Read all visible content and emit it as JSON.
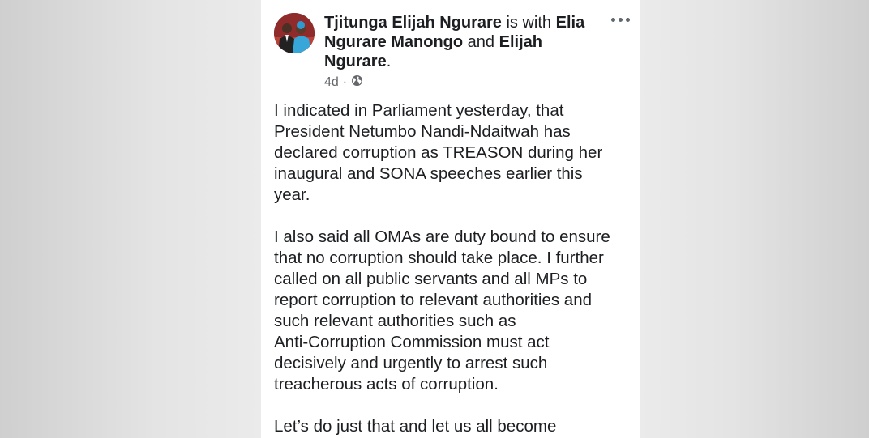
{
  "post": {
    "author": "Tjitunga Elijah Ngurare",
    "with_text": " is with ",
    "tagged_1": "Elia Ngurare Manongo",
    "and_text": " and ",
    "tagged_2": "Elijah Ngurare",
    "end_text": ".",
    "time": "4d",
    "separator": "·",
    "audience_icon": "globe-icon",
    "more_icon": "more-options-icon",
    "paragraphs": {
      "p1": "I indicated in Parliament yesterday, that\nPresident Netumbo Nandi-Ndaitwah has\ndeclared corruption as TREASON during her\ninaugural and SONA speeches earlier this\nyear.",
      "p2": "I also said all OMAs are duty bound to ensure\nthat no corruption should take place. I further\ncalled on all public servants and all MPs to\nreport corruption to relevant authorities and\nsuch relevant authorities such as\nAnti-Corruption Commission must act\ndecisively and urgently to arrest such\ntreacherous acts of corruption.",
      "p3": "Let’s do just that and let us all become"
    }
  }
}
